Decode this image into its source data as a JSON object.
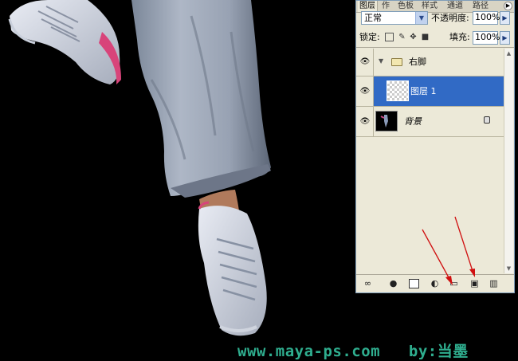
{
  "window_tab_strip": {
    "tabs": [
      "图层",
      "作",
      "色板",
      "样式",
      "通道",
      "路径"
    ]
  },
  "layers_panel": {
    "blend_mode": "正常",
    "opacity_label": "不透明度:",
    "opacity_value": "100%",
    "lock_label": "锁定:",
    "fill_label": "填充:",
    "fill_value": "100%",
    "layers": [
      {
        "name": "右脚",
        "type": "group",
        "visible": true,
        "selected": false
      },
      {
        "name": "图层 1",
        "type": "layer",
        "visible": true,
        "selected": true
      },
      {
        "name": "背景",
        "type": "background",
        "visible": true,
        "selected": false,
        "locked": true
      }
    ]
  },
  "colors": {
    "panel_bg": "#ece9d8",
    "selection": "#316ac5",
    "watermark": "#2fae8f",
    "arrow": "#d01010"
  },
  "watermark": {
    "url": "www.maya-ps.com",
    "author": "by:当墨"
  }
}
